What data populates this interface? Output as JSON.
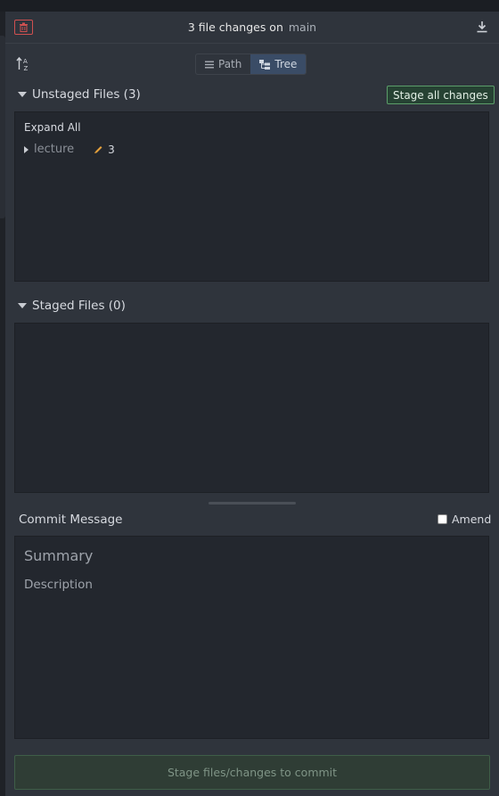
{
  "header": {
    "title": "3 file changes on",
    "branch": "main"
  },
  "view_toggle": {
    "path_label": "Path",
    "tree_label": "Tree",
    "selected": "Tree"
  },
  "unstaged": {
    "title": "Unstaged Files (3)",
    "stage_all_label": "Stage all changes",
    "expand_all_label": "Expand All",
    "tree": [
      {
        "name": "lecture",
        "change_count": "3",
        "icon": "pencil-icon"
      }
    ]
  },
  "staged": {
    "title": "Staged Files (0)"
  },
  "commit": {
    "label": "Commit Message",
    "amend_label": "Amend",
    "amend_checked": false,
    "summary_placeholder": "Summary",
    "description_placeholder": "Description",
    "submit_label": "Stage files/changes to commit"
  },
  "colors": {
    "accent_green": "#5c9e6a",
    "danger_red": "#d05050",
    "pencil_orange": "#e6a23c",
    "selected_tab": "#3a4c66"
  }
}
